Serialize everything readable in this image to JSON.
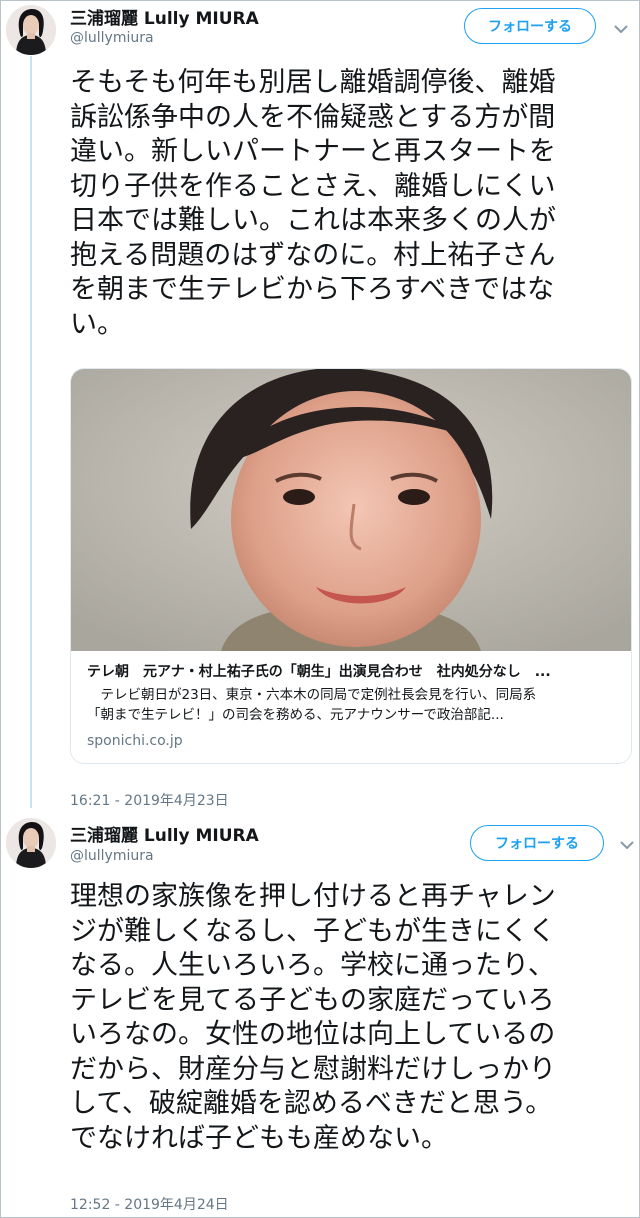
{
  "colors": {
    "accent": "#1da1f2",
    "muted": "#657786",
    "thread": "#c4e3f5"
  },
  "tweets": [
    {
      "author_name": "三浦瑠麗 Lully MIURA",
      "handle": "@lullymiura",
      "follow_label": "フォローする",
      "text_lines": [
        "そもそも何年も別居し離婚調停後、離婚",
        "訴訟係争中の人を不倫疑惑とする方が間",
        "違い。新しいパートナーと再スタートを",
        "切り子供を作ることさえ、離婚しにくい",
        "日本では難しい。これは本来多くの人が",
        "抱える問題のはずなのに。村上祐子さん",
        "を朝まで生テレビから下ろすべきではな",
        "い。"
      ],
      "card": {
        "title": "テレ朝　元アナ・村上祐子氏の「朝生」出演見合わせ　社内処分なし　...",
        "description_lines": [
          "　テレビ朝日が23日、東京・六本木の同局で定例社長会見を行い、同局系",
          "「朝まで生テレビ！」の司会を務める、元アナウンサーで政治部記..."
        ],
        "domain": "sponichi.co.jp"
      },
      "timestamp": "16:21 - 2019年4月23日"
    },
    {
      "author_name": "三浦瑠麗 Lully MIURA",
      "handle": "@lullymiura",
      "follow_label": "フォローする",
      "text_lines": [
        "理想の家族像を押し付けると再チャレン",
        "ジが難しくなるし、子どもが生きにくく",
        "なる。人生いろいろ。学校に通ったり、",
        "テレビを見てる子どもの家庭だっていろ",
        "いろなの。女性の地位は向上しているの",
        "だから、財産分与と慰謝料だけしっかり",
        "して、破綻離婚を認めるべきだと思う。",
        "でなければ子どもも産めない。"
      ],
      "timestamp": "12:52 - 2019年4月24日"
    }
  ]
}
